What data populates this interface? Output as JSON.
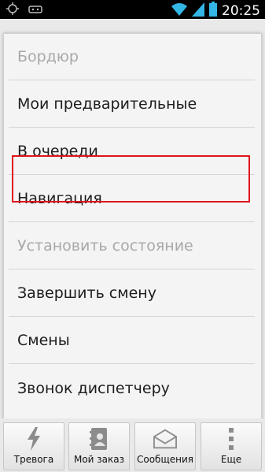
{
  "status_bar": {
    "time": "20:25",
    "icons": [
      "gps-icon",
      "bbm-icon",
      "wifi-icon",
      "signal-icon",
      "battery-icon"
    ]
  },
  "menu": {
    "items": [
      {
        "label": "Бордюр",
        "enabled": false
      },
      {
        "label": "Мои предварительные",
        "enabled": true
      },
      {
        "label": "В очереди",
        "enabled": true,
        "highlighted": true
      },
      {
        "label": "Навигация",
        "enabled": true
      },
      {
        "label": "Установить состояние",
        "enabled": false
      },
      {
        "label": "Завершить смену",
        "enabled": true
      },
      {
        "label": "Смены",
        "enabled": true
      },
      {
        "label": "Звонок диспетчеру",
        "enabled": true
      }
    ]
  },
  "bottom_bar": {
    "buttons": [
      {
        "label": "Тревога",
        "icon": "lightning-icon"
      },
      {
        "label": "Мой заказ",
        "icon": "contact-book-icon"
      },
      {
        "label": "Сообщения",
        "icon": "envelope-icon"
      },
      {
        "label": "Еще",
        "icon": "more-vertical-icon"
      }
    ]
  },
  "colors": {
    "highlight_border": "#e1141b",
    "status_icon_cyan": "#33b5e5"
  }
}
